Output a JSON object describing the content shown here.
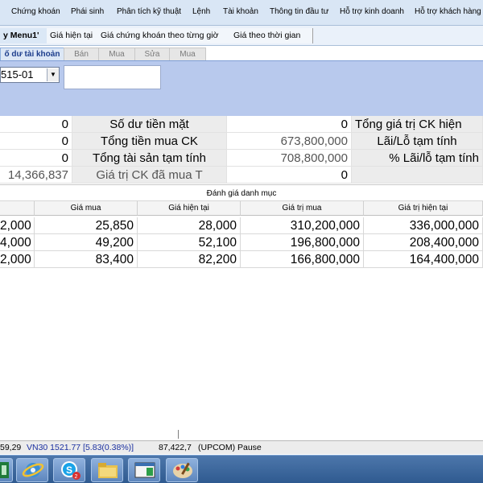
{
  "menu": [
    "Chứng khoán",
    "Phái sinh",
    "Phân tích kỹ thuật",
    "Lệnh",
    "Tài khoản",
    "Thông tin đầu tư",
    "Hỗ trợ kinh doanh",
    "Hỗ trợ khách hàng"
  ],
  "toolbar": [
    "y Menu1'",
    "Giá hiện tại",
    "Giá chứng khoán theo từng giờ",
    "Giá theo thời gian"
  ],
  "subtabs": [
    "ố dư tài khoản",
    "Bán",
    "Mua",
    "Sửa",
    "Mua"
  ],
  "account": {
    "selected": "515-01"
  },
  "summary": {
    "col0": [
      "0",
      "0",
      "0",
      "14,366,837"
    ],
    "col1": [
      "Số dư tiền mặt",
      "Tổng tiền mua CK",
      "Tổng tài sản tạm tính",
      "Giá trị CK đã mua T"
    ],
    "col2": [
      "0",
      "673,800,000",
      "708,800,000",
      "0"
    ],
    "col3": [
      "Tổng giá trị CK hiện",
      "Lãi/Lỗ tạm tính",
      "% Lãi/lỗ tạm tính",
      ""
    ]
  },
  "portfolio": {
    "title": "Đánh giá danh mục",
    "headers": [
      "",
      "Giá mua",
      "Giá hiện tại",
      "Giá trị mua",
      "Giá trị hiện tại"
    ],
    "rows": [
      [
        "2,000",
        "25,850",
        "28,000",
        "310,200,000",
        "336,000,000"
      ],
      [
        "4,000",
        "49,200",
        "52,100",
        "196,800,000",
        "208,400,000"
      ],
      [
        "2,000",
        "83,400",
        "82,200",
        "166,800,000",
        "164,400,000"
      ]
    ]
  },
  "status": {
    "left": "59,29",
    "vn30": "VN30 1521.77 [5.83(0.38%)]",
    "right": "87,422,7",
    "upcom": "(UPCOM) Pause"
  },
  "taskbar": [
    "excel-icon",
    "ie-icon",
    "skype-icon",
    "folder-icon",
    "window-icon",
    "paint-icon"
  ],
  "colors": {
    "account_panel": "#b8c9ed",
    "active_tab": "#1c3d8c",
    "vn30_text": "#1a2fa0"
  }
}
